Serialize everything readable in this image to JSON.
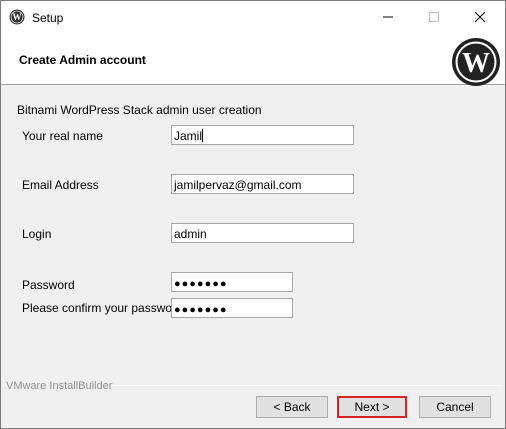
{
  "window": {
    "title": "Setup",
    "icon": "wordpress-icon",
    "controls": [
      "minimize-icon",
      "maximize-icon",
      "close-icon"
    ]
  },
  "header": {
    "title": "Create Admin account",
    "logo": "wordpress-logo-icon"
  },
  "form": {
    "section_title": "Bitnami WordPress Stack admin user creation",
    "fields": [
      {
        "label": "Your real name",
        "value": "Jamil",
        "type": "text",
        "focused": true
      },
      {
        "label": "Email Address",
        "value": "jamilpervaz@gmail.com",
        "type": "text"
      },
      {
        "label": "Login",
        "value": "admin",
        "type": "text"
      },
      {
        "label": "Password",
        "value": "●●●●●●●",
        "type": "password"
      },
      {
        "label": "Please confirm your password",
        "value": "●●●●●●●",
        "type": "password"
      }
    ]
  },
  "footer": {
    "brand": "VMware InstallBuilder",
    "back_label": "< Back",
    "next_label": "Next >",
    "cancel_label": "Cancel"
  },
  "colors": {
    "highlight": "#d42424",
    "window_bg": "#f0f0f0",
    "field_border": "#a6a6a6"
  }
}
